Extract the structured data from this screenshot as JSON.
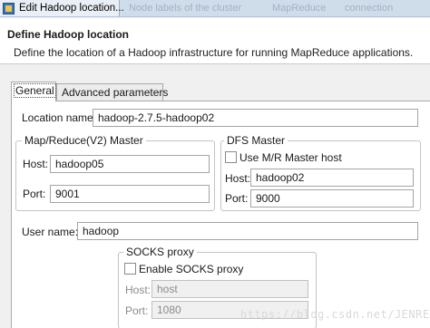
{
  "window": {
    "title": "Edit Hadoop location...",
    "ghost_tabs": [
      "Node labels of the cluster",
      "MapReduce",
      "connection"
    ]
  },
  "header": {
    "title": "Define Hadoop location",
    "description": "Define the location of a Hadoop infrastructure for running MapReduce applications."
  },
  "tabs": {
    "general": "General",
    "advanced": "Advanced parameters"
  },
  "form": {
    "location_name_label": "Location name:",
    "location_name_value": "hadoop-2.7.5-hadoop02",
    "mr_master": {
      "legend": "Map/Reduce(V2) Master",
      "host_label": "Host:",
      "host_value": "hadoop05",
      "port_label": "Port:",
      "port_value": "9001"
    },
    "dfs_master": {
      "legend": "DFS Master",
      "use_mr_label": "Use M/R Master host",
      "host_label": "Host:",
      "host_value": "hadoop02",
      "port_label": "Port:",
      "port_value": "9000"
    },
    "user_name_label": "User name:",
    "user_name_value": "hadoop",
    "socks": {
      "legend": "SOCKS proxy",
      "enable_label": "Enable SOCKS proxy",
      "host_label": "Host:",
      "host_value": "host",
      "port_label": "Port:",
      "port_value": "1080"
    }
  },
  "watermark": "https://blog.csdn.net/JENREY"
}
